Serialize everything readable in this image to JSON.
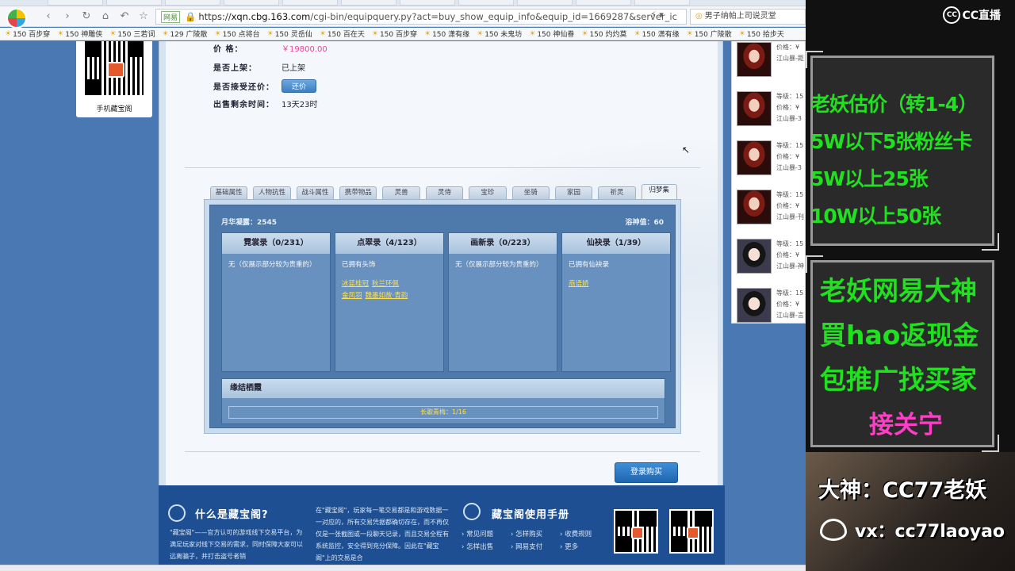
{
  "browser": {
    "address": {
      "tag": "网易",
      "scheme": "https://",
      "host": "xqn.cbg.163.com",
      "path": "/cgi-bin/equipquery.py?act=buy_show_equip_info&equip_id=1669287&server_ic"
    },
    "search_text": "男子纳帕上司说灵堂",
    "bookmarks": [
      "150 百步穿",
      "150 神雕侠",
      "150 三若词",
      "129 广陵散",
      "150 点将台",
      "150 灵岳仙",
      "150 百在天",
      "150 百步穿",
      "150 潇有缘",
      "150 未鬼坊",
      "150 神仙眷",
      "150 灼灼莫",
      "150 潇有缘",
      "150 广陵散",
      "150 拾步天"
    ]
  },
  "qr": {
    "caption": "手机藏宝阁"
  },
  "equip": {
    "price_label": "价      格：",
    "price": "￥19800.00",
    "status_label": "是否上架：",
    "status": "已上架",
    "bargain_label": "是否接受还价：",
    "bargain_button": "还价",
    "time_label": "出售剩余时间：",
    "time_left": "13天23时"
  },
  "tabs": [
    "基础属性",
    "人物抗性",
    "战斗属性",
    "携带物品",
    "灵兽",
    "灵侍",
    "宝珍",
    "坐骑",
    "家园",
    "祈灵",
    "归梦集"
  ],
  "panel": {
    "moon_label": "月华凝露：2545",
    "spirit_label": "浴神值：60",
    "cards": [
      {
        "title": "霓裳录（0/231）",
        "text": "无（仅展示部分较为贵重的）",
        "links": []
      },
      {
        "title": "点翠录（4/123）",
        "text": "已拥有头饰",
        "links": [
          [
            "冰蓝桂冠",
            "秋兰环佩"
          ],
          [
            "金凤羽",
            "魏墨如故·青韵"
          ]
        ]
      },
      {
        "title": "画新录（0/223）",
        "text": "无（仅展示部分较为贵重的）",
        "links": []
      },
      {
        "title": "仙袂录（1/39）",
        "text": "已拥有仙袂录",
        "links": [
          [
            "燕语娇"
          ]
        ]
      }
    ],
    "fate_title": "缘结栖霞",
    "fate_bar": "长歌青梅：1/16"
  },
  "login_button": "登录购买",
  "right_list": [
    {
      "level": "",
      "price": "价格：¥",
      "server": "江山暴-距"
    },
    {
      "level": "等级：15",
      "price": "价格：¥",
      "server": "江山暴-3"
    },
    {
      "level": "等级：15",
      "price": "价格：¥",
      "server": "江山暴-3"
    },
    {
      "level": "等级：15",
      "price": "价格：¥",
      "server": "江山暴-刊"
    },
    {
      "level": "等级：15",
      "price": "价格：¥",
      "server": "江山暴-神"
    },
    {
      "level": "等级：15",
      "price": "价格：¥",
      "server": "江山暴-言"
    }
  ],
  "footer": {
    "title1": "什么是藏宝阁?",
    "text1": "\"藏宝阁\"——官方认可的游戏线下交易平台，为满足玩家对线下交易的需求，同时保障大家可以远离骗子，并打击盗号者销",
    "text2": "在\"藏宝阁\"，玩家每一笔交易都是和游戏数据一一对应的，所有交易凭据都确切存在，而不再仅仅是一张截图或一段聊天记录，而且交易全程有系统监控，安全得到充分保障。因此在\"藏宝阁\"上的交易是合",
    "title2": "藏宝阁使用手册",
    "links": [
      "常见问题",
      "怎样购买",
      "收费规则",
      "怎样出售",
      "网易支付",
      "更多"
    ]
  },
  "stream": {
    "logo": "CC直播",
    "lines1": [
      "老妖估价（转1-4）",
      "5W以下5张粉丝卡",
      "5W以上25张",
      "10W以上50张"
    ],
    "lines2": [
      "老妖网易大神",
      "買hao返现金",
      "包推广找买家"
    ],
    "pink": "接关宁",
    "dashen": "大神：CC77老妖",
    "vx": "vx：cc77laoyao"
  }
}
